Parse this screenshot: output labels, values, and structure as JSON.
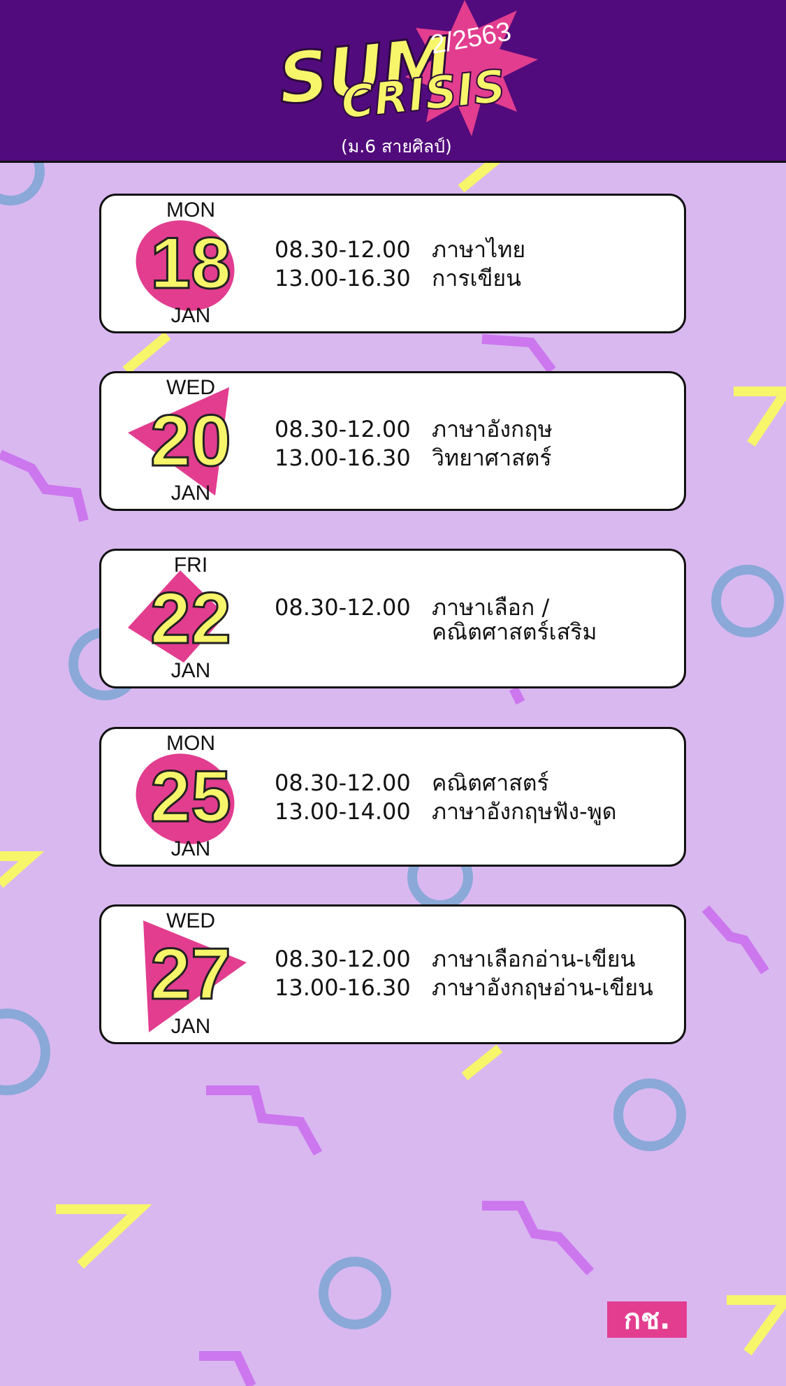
{
  "header": {
    "title_sum": "SUM",
    "title_year": "2/2563",
    "title_crisis": "CRISIS",
    "subtitle": "(ม.6 สายศิลป์)"
  },
  "days": [
    {
      "dow": "MON",
      "day": "18",
      "month": "JAN",
      "shape": "blob",
      "sessions": [
        {
          "time": "08.30-12.00",
          "subject": "ภาษาไทย"
        },
        {
          "time": "13.00-16.30",
          "subject": "การเขียน"
        }
      ]
    },
    {
      "dow": "WED",
      "day": "20",
      "month": "JAN",
      "shape": "triangle",
      "sessions": [
        {
          "time": "08.30-12.00",
          "subject": "ภาษาอังกฤษ"
        },
        {
          "time": "13.00-16.30",
          "subject": "วิทยาศาสตร์"
        }
      ]
    },
    {
      "dow": "FRI",
      "day": "22",
      "month": "JAN",
      "shape": "diamond",
      "sessions": [
        {
          "time": "08.30-12.00",
          "subject": "ภาษาเลือก /\nคณิตศาสตร์เสริม"
        }
      ]
    },
    {
      "dow": "MON",
      "day": "25",
      "month": "JAN",
      "shape": "blob",
      "sessions": [
        {
          "time": "08.30-12.00",
          "subject": "คณิตศาสตร์"
        },
        {
          "time": "13.00-14.00",
          "subject": "ภาษาอังกฤษฟัง-พูด"
        }
      ]
    },
    {
      "dow": "WED",
      "day": "27",
      "month": "JAN",
      "shape": "triangle",
      "sessions": [
        {
          "time": "08.30-12.00",
          "subject": "ภาษาเลือกอ่าน-เขียน"
        },
        {
          "time": "13.00-16.30",
          "subject": "ภาษาอังกฤษอ่าน-เขียน"
        }
      ]
    }
  ],
  "brand_label": "กช.",
  "colors": {
    "background": "#d9b8f0",
    "header": "#520b7c",
    "accent_pink": "#e23d8f",
    "accent_yellow": "#f7f56a",
    "deco_purple": "#cc77ee",
    "deco_blue": "#8aa8d8"
  }
}
